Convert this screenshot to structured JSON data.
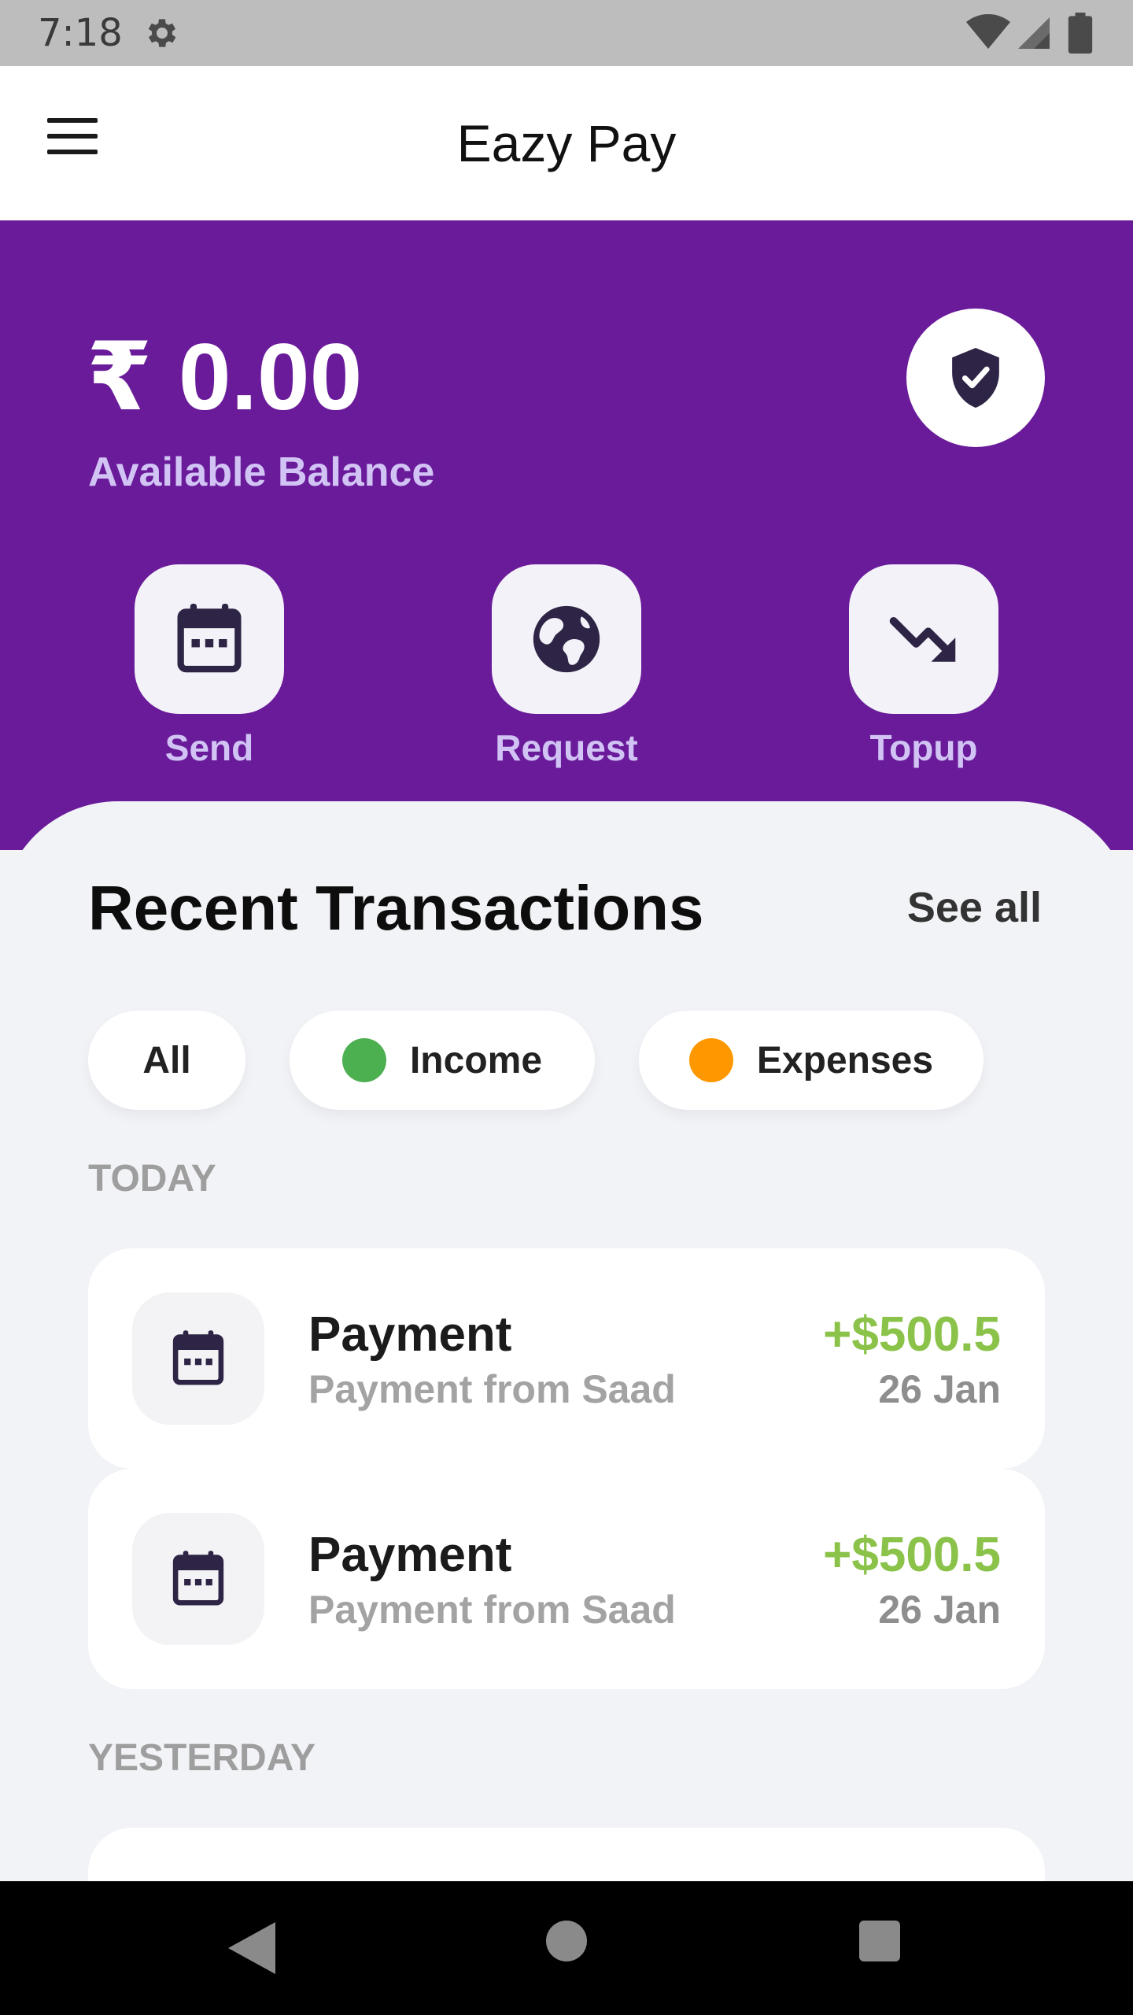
{
  "status_bar": {
    "time": "7:18",
    "icons": [
      "gear-icon",
      "wifi-icon",
      "signal-icon",
      "battery-icon"
    ]
  },
  "app_bar": {
    "title": "Eazy Pay",
    "menu_icon": "hamburger-menu-icon"
  },
  "balance": {
    "amount": "₹ 0.00",
    "label": "Available Balance",
    "shield_icon": "verified-shield-icon"
  },
  "actions": [
    {
      "label": "Send",
      "icon": "calendar-icon"
    },
    {
      "label": "Request",
      "icon": "globe-icon"
    },
    {
      "label": "Topup",
      "icon": "trending-down-icon"
    }
  ],
  "transactions_section": {
    "title": "Recent Transactions",
    "see_all": "See all",
    "filters": [
      {
        "label": "All",
        "dot_color": null
      },
      {
        "label": "Income",
        "dot_color": "#4caf50"
      },
      {
        "label": "Expenses",
        "dot_color": "#ff9800"
      }
    ],
    "groups": [
      {
        "label": "TODAY",
        "items": [
          {
            "title": "Payment",
            "subtitle": "Payment from Saad",
            "amount": "+$500.5",
            "date": "26 Jan",
            "icon": "calendar-icon"
          },
          {
            "title": "Payment",
            "subtitle": "Payment from Saad",
            "amount": "+$500.5",
            "date": "26 Jan",
            "icon": "calendar-icon"
          }
        ]
      },
      {
        "label": "YESTERDAY",
        "items": []
      }
    ]
  },
  "colors": {
    "brand_purple": "#6a1b9a",
    "accent_lavender": "#d1c4f5",
    "income_green": "#8bc34a",
    "icon_dark": "#2e2445"
  },
  "nav_bar": {
    "icons": [
      "back-icon",
      "home-icon",
      "recent-apps-icon"
    ]
  }
}
